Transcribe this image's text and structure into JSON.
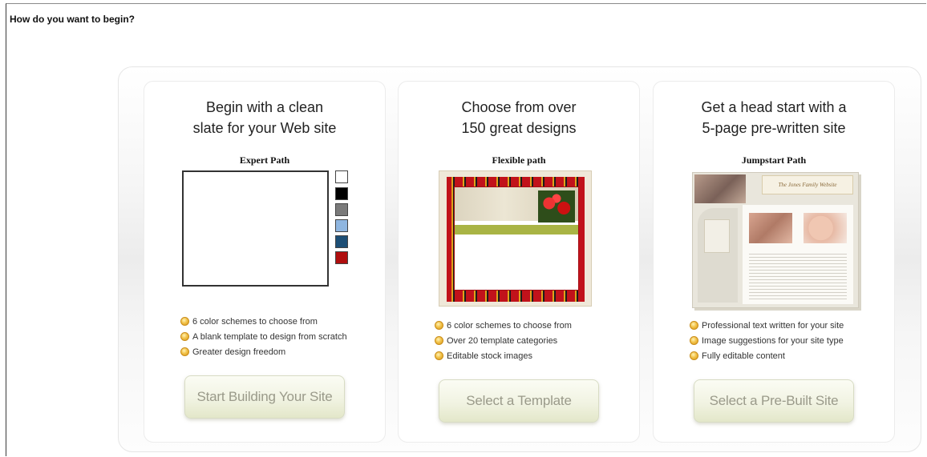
{
  "page": {
    "title": "How do you want to begin?"
  },
  "cards": [
    {
      "heading": "Begin with a clean\nslate for your Web site",
      "path_label": "Expert Path",
      "features": [
        "6 color schemes to choose from",
        "A blank template to design from scratch",
        "Greater design freedom"
      ],
      "button_label": "Start Building Your Site",
      "swatch_colors": [
        "#ffffff",
        "#000000",
        "#7a7a7a",
        "#8fb6e0",
        "#1d4e75",
        "#b00e0e"
      ]
    },
    {
      "heading": "Choose from over\n150 great designs",
      "path_label": "Flexible path",
      "features": [
        "6 color schemes to choose from",
        "Over 20 template categories",
        "Editable stock images"
      ],
      "button_label": "Select a Template"
    },
    {
      "heading": "Get a head start with a\n5-page pre-written site",
      "path_label": "Jumpstart Path",
      "features": [
        "Professional text written for your site",
        "Image suggestions for your site type",
        "Fully editable content"
      ],
      "button_label": "Select a Pre-Built Site",
      "thumb_title": "The Jones Family Website"
    }
  ],
  "colors": {
    "bullet": "#f2c24a",
    "button_text": "#9a9a8a",
    "button_bg": "#f1f3e2"
  }
}
